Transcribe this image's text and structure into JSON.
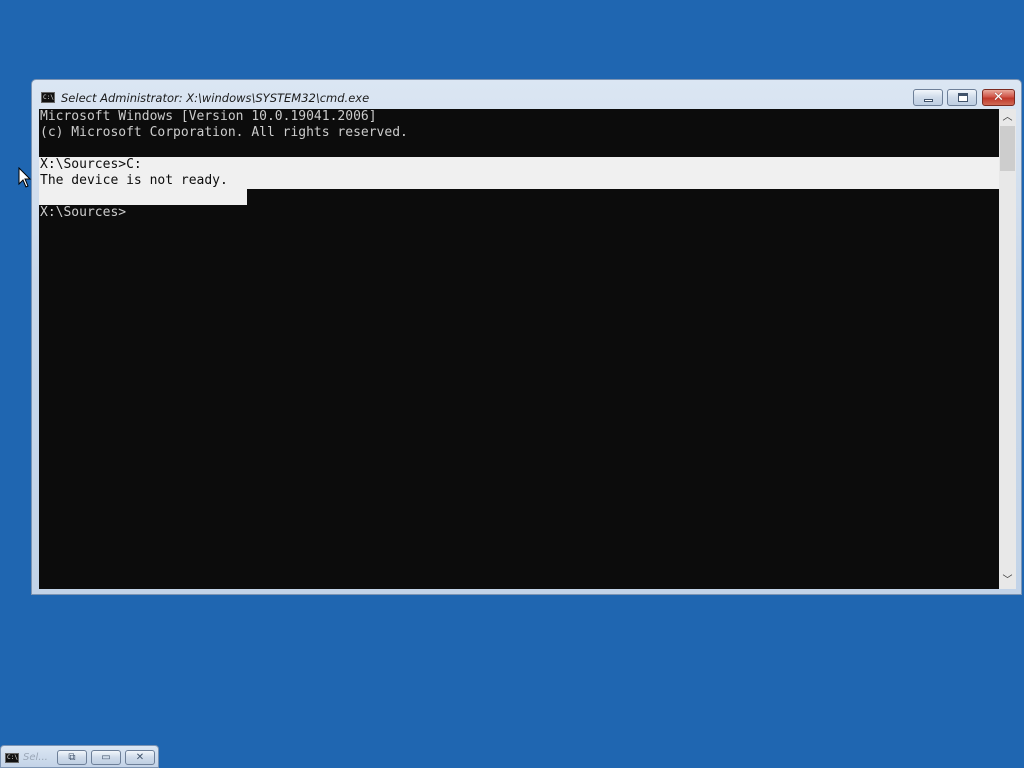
{
  "window": {
    "title": "Select Administrator: X:\\windows\\SYSTEM32\\cmd.exe",
    "icon": "cmd-console-icon",
    "icon_text": "C:\\",
    "buttons": {
      "minimize_icon": "minimize-icon",
      "maximize_icon": "maximize-icon",
      "close_glyph": "✕"
    }
  },
  "console": {
    "lines": [
      "Microsoft Windows [Version 10.0.19041.2006]",
      "(c) Microsoft Corporation. All rights reserved.",
      "",
      "X:\\Sources>C:",
      "The device is not ready.",
      "",
      "X:\\Sources>"
    ],
    "colors": {
      "background": "#0c0c0c",
      "foreground": "#cccccc",
      "selection": "#f0f0f0"
    }
  },
  "scrollbar": {
    "up_arrow": "︿",
    "down_arrow": "﹀"
  },
  "minimized_window": {
    "title": "Sel...",
    "icon_text": "C:\\",
    "restore_glyph": "⧉",
    "maximize_glyph": "▭",
    "close_glyph": "✕"
  },
  "desktop": {
    "background": "#1f66b1"
  }
}
